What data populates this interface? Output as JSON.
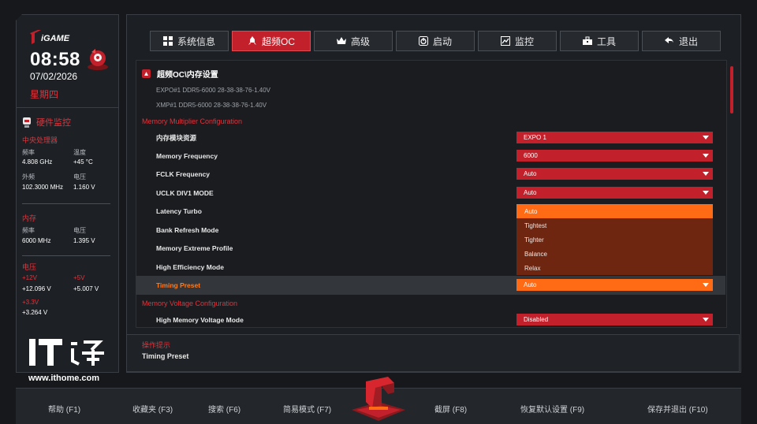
{
  "left_panel": {
    "logo_text": "iGAME",
    "time": "08:58",
    "date": "07/02/2026",
    "weekday": "星期四",
    "hw_monitor_title": "硬件监控",
    "cpu": {
      "title": "中央处理器",
      "freq_label": "频率",
      "freq_value": "4.808 GHz",
      "temp_label": "温度",
      "temp_value": "+45 °C",
      "ext_label": "外频",
      "ext_value": "102.3000 MHz",
      "volt_label": "电压",
      "volt_value": "1.160 V"
    },
    "memory": {
      "title": "内存",
      "freq_label": "频率",
      "freq_value": "6000 MHz",
      "volt_label": "电压",
      "volt_value": "1.395 V"
    },
    "voltage": {
      "title": "电压",
      "v12_label": "+12V",
      "v12_value": "+12.096 V",
      "v5_label": "+5V",
      "v5_value": "+5.007 V",
      "v33_label": "+3.3V",
      "v33_value": "+3.264 V"
    }
  },
  "watermark": {
    "logo": "IT之家",
    "url": "www.ithome.com"
  },
  "tabs": [
    {
      "label": "系统信息",
      "icon": "grid-icon",
      "active": false
    },
    {
      "label": "超频OC",
      "icon": "rocket-icon",
      "active": true
    },
    {
      "label": "高级",
      "icon": "crown-icon",
      "active": false
    },
    {
      "label": "启动",
      "icon": "power-icon",
      "active": false
    },
    {
      "label": "监控",
      "icon": "chart-icon",
      "active": false
    },
    {
      "label": "工具",
      "icon": "toolbox-icon",
      "active": false
    },
    {
      "label": "退出",
      "icon": "back-arrow-icon",
      "active": false
    }
  ],
  "content": {
    "breadcrumb": "超频OC\\内存设置",
    "expo_line": "EXPO#1 DDR5-6000 28-38-38-76-1.40V",
    "xmp_line": "XMP#1  DDR5-6000 28-38-38-76-1.40V",
    "section1": "Memory Multiplier Configuration",
    "rows": [
      {
        "label": "内存模块资源",
        "value": "EXPO 1"
      },
      {
        "label": "Memory Frequency",
        "value": "6000"
      },
      {
        "label": "FCLK Frequency",
        "value": "Auto"
      },
      {
        "label": "UCLK DIV1 MODE",
        "value": "Auto"
      },
      {
        "label": "Latency Turbo"
      },
      {
        "label": "Bank Refresh Mode"
      },
      {
        "label": "Memory Extreme Profile"
      },
      {
        "label": "High Efficiency Mode"
      },
      {
        "label": "Timing Preset",
        "value": "Auto"
      }
    ],
    "dropdown_options": [
      "Auto",
      "Tightest",
      "Tighter",
      "Balance",
      "Relax"
    ],
    "section2": "Memory Voltage Configuration",
    "voltage_row": {
      "label": "High Memory Voltage Mode",
      "value": "Disabled"
    }
  },
  "help": {
    "title": "操作提示",
    "text": "Timing Preset"
  },
  "bottom_bar": [
    "帮助 (F1)",
    "收藏夹 (F3)",
    "搜索 (F6)",
    "简易模式 (F7)",
    "截屏 (F8)",
    "恢复默认设置 (F9)",
    "保存并退出 (F10)"
  ],
  "colors": {
    "accent_red": "#c2202a",
    "accent_orange": "#ff6a14",
    "label_red": "#e0343c"
  }
}
